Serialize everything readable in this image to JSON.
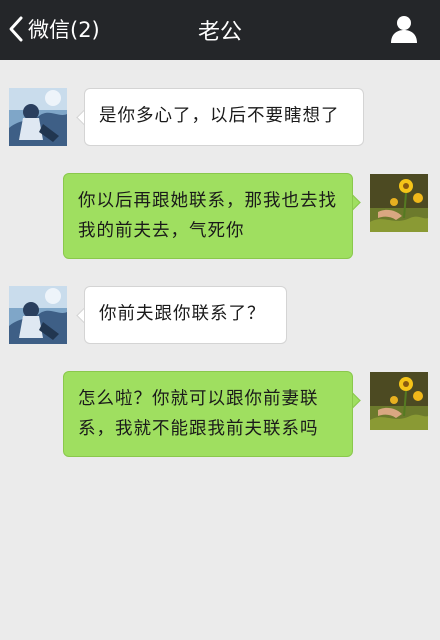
{
  "nav": {
    "back_label": "微信(2)",
    "title": "老公",
    "back_icon": "chevron-left-icon",
    "profile_icon": "person-icon"
  },
  "colors": {
    "nav_bg": "#242629",
    "chat_bg": "#ebebeb",
    "outgoing_bubble": "#9fdf60",
    "incoming_bubble": "#ffffff"
  },
  "messages": [
    {
      "sender": "contact",
      "text": "是你多心了，以后不要瞎想了"
    },
    {
      "sender": "me",
      "text": "你以后再跟她联系，那我也去找我的前夫去，气死你"
    },
    {
      "sender": "contact",
      "text": "你前夫跟你联系了？"
    },
    {
      "sender": "me",
      "text": "怎么啦？你就可以跟你前妻联系，我就不能跟我前夫联系吗"
    }
  ]
}
